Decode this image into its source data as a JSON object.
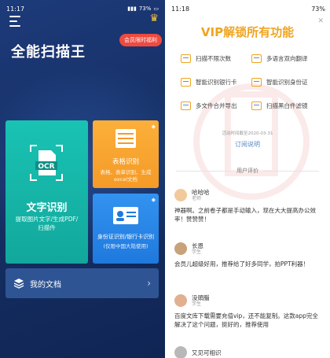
{
  "left": {
    "status": {
      "time": "11:17",
      "right": "73%"
    },
    "promo_badge": "会员限时福利",
    "app_title": "全能扫描王",
    "ocr_card": {
      "badge": "OCR",
      "title": "文字识别",
      "desc": "提取图片文字/生成PDF/扫描件"
    },
    "table_card": {
      "title": "表格识别",
      "desc": "表格、表单识别，生成excel文档"
    },
    "id_card": {
      "title": "身份证识别/银行卡识别",
      "desc": "(仅限中国大陆使用)"
    },
    "docs": {
      "label": "我的文档"
    }
  },
  "right": {
    "status": {
      "time": "11:18",
      "right": "73%"
    },
    "vip_title": "VIP解锁所有功能",
    "features": [
      {
        "label": "扫描不限次数",
        "icon": "scan-icon"
      },
      {
        "label": "多语言双向翻译",
        "icon": "translate-icon"
      },
      {
        "label": "智能识别银行卡",
        "icon": "bankcard-icon"
      },
      {
        "label": "智能识别身份证",
        "icon": "idcard-icon"
      },
      {
        "label": "多文件合并导出",
        "icon": "merge-icon"
      },
      {
        "label": "扫描黑白件滤镜",
        "icon": "filter-icon"
      }
    ],
    "validity": "活动时间截至2020-03-31",
    "subscribe_link": "订阅说明",
    "reviews_heading": "用户评价",
    "reviews": [
      {
        "name": "哈哈哈",
        "role": "老师",
        "text": "神器啊。之前卷子都是手动输入，现在大大提高办公效率！赞赞赞！",
        "avatar_color": "#f2c99a"
      },
      {
        "name": "长恩",
        "role": "学生",
        "text": "会员儿超级好用，推荐给了好多同学，拍PPT利器！",
        "avatar_color": "#c7a27a"
      },
      {
        "name": "没頭腦",
        "role": "学生",
        "text": "百度文库下载需要充值vip，还不能复制。这款app完全解决了这个问题，挺好的，推荐使用",
        "avatar_color": "#e0b090"
      },
      {
        "name": "又见可相识",
        "role": "",
        "text": "",
        "avatar_color": "#b8b8b8"
      }
    ]
  }
}
